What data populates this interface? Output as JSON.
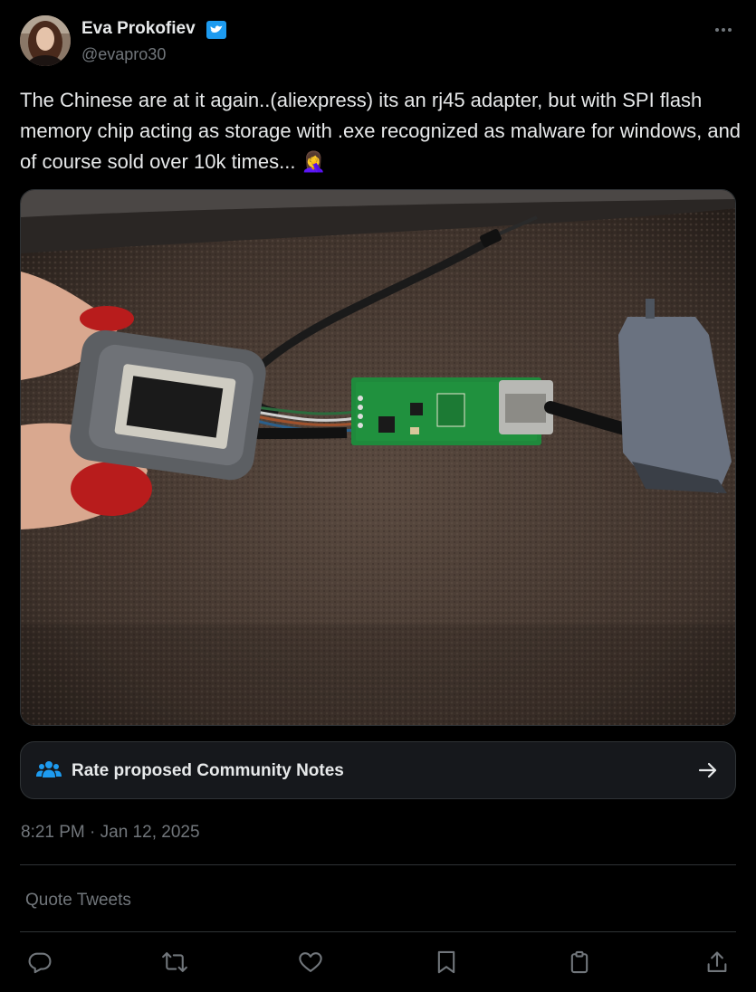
{
  "author": {
    "name": "Eva Prokofiev",
    "handle": "@evapro30",
    "verified": true,
    "avatar": "avatar-photo"
  },
  "tweet": {
    "text": "The Chinese are at it again..(aliexpress) its an rj45 adapter, but with SPI flash memory chip acting as storage with .exe recognized as malware for windows, and of course sold over 10k times... 🤦‍♀️"
  },
  "media": {
    "type": "photo",
    "icon": "usb-rj45-adapter-photo"
  },
  "community_notes": {
    "label": "Rate proposed Community Notes",
    "icon": "people-icon",
    "arrow_icon": "arrow-right-icon"
  },
  "timestamp": "8:21 PM · Jan 12, 2025",
  "quote_tweets_label": "Quote Tweets",
  "actions": [
    {
      "name": "reply",
      "icon": "reply-icon"
    },
    {
      "name": "retweet",
      "icon": "retweet-icon"
    },
    {
      "name": "like",
      "icon": "heart-icon"
    },
    {
      "name": "bookmark",
      "icon": "bookmark-icon"
    },
    {
      "name": "copy",
      "icon": "clipboard-icon"
    },
    {
      "name": "share",
      "icon": "share-icon"
    }
  ],
  "colors": {
    "background": "#000000",
    "text_primary": "#e7e9ea",
    "text_secondary": "#71767b",
    "border": "#2f3336",
    "verified_blue": "#1d9bf0",
    "notes_icon_blue": "#1d9bf0"
  }
}
